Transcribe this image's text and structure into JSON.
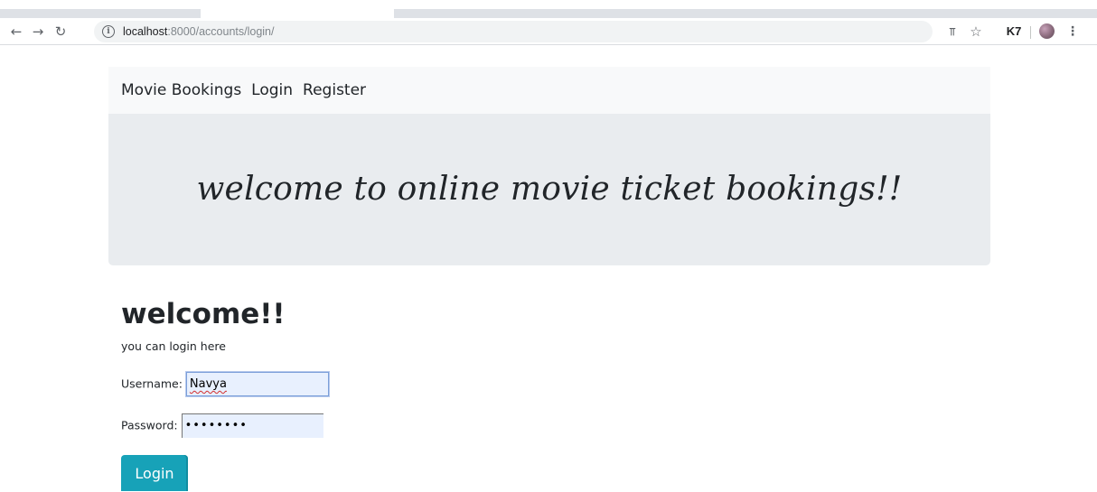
{
  "browser": {
    "url_host": "localhost",
    "url_path": ":8000/accounts/login/",
    "extension_label": "K7"
  },
  "nav": {
    "brand": "Movie Bookings",
    "links": [
      "Login",
      "Register"
    ]
  },
  "jumbotron": {
    "title": "welcome to online movie ticket bookings!!"
  },
  "login": {
    "heading": "welcome!!",
    "subtext": "you can login here",
    "username_label": "Username:",
    "username_value": "Navya",
    "password_label": "Password:",
    "password_value": "••••••••",
    "submit_label": "Login"
  },
  "colors": {
    "button": "#17a2b8",
    "navbar_bg": "#f8f9fa",
    "jumbotron_bg": "#e9ecef",
    "autofill_bg": "#e8f0fe"
  },
  "icons": [
    "back-arrow-icon",
    "forward-arrow-icon",
    "reload-icon",
    "info-icon",
    "key-icon",
    "star-icon",
    "extension-icon",
    "avatar",
    "menu-icon"
  ]
}
